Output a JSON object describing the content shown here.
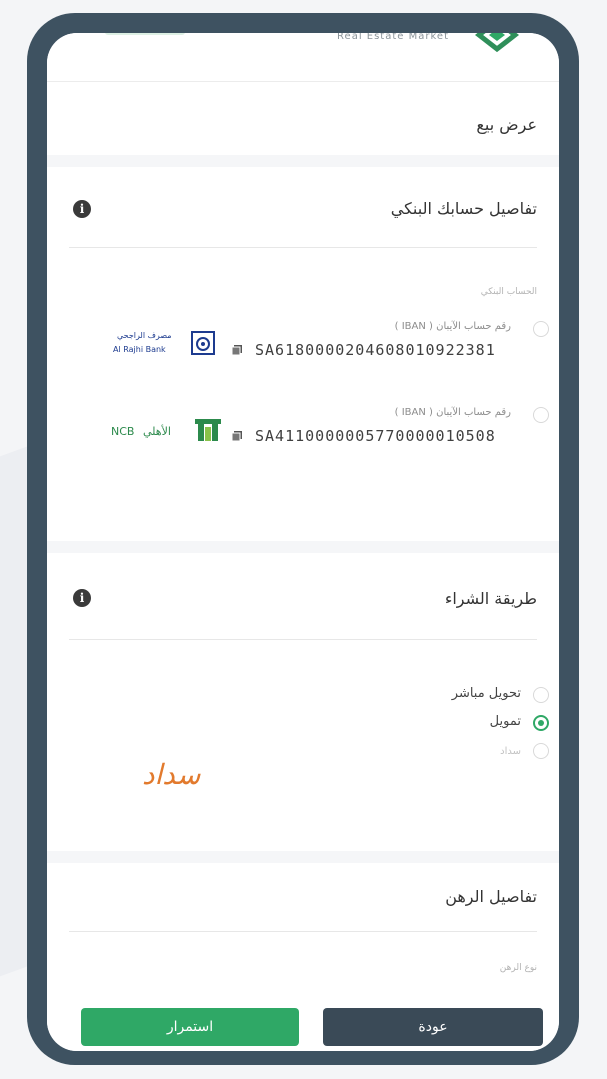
{
  "header": {
    "brand_text": "Real Estate Market"
  },
  "page_title": "عرض بيع",
  "bank_section": {
    "title": "تفاصيل حسابك البنكي",
    "info_icon": "i",
    "group_label": "الحساب البنكي",
    "accounts": [
      {
        "label": "رقم حساب الآيبان ( IBAN )",
        "iban": "SA6180000204608010922381",
        "bank_ar": "مصرف الراجحي",
        "bank_en": "Al Rajhi Bank",
        "icon": "alrajhi-logo"
      },
      {
        "label": "رقم حساب الآيبان ( IBAN )",
        "iban": "SA4110000005770000010508",
        "bank_ar": "الأهلي",
        "bank_en": "NCB",
        "icon": "ncb-logo"
      }
    ]
  },
  "purchase_section": {
    "title": "طريقة الشراء",
    "info_icon": "i",
    "options": [
      {
        "label": "تحويل مباشر",
        "selected": false
      },
      {
        "label": "تمويل",
        "selected": true
      },
      {
        "label": "سداد",
        "selected": false
      }
    ],
    "sadad_logo_text": "سداد"
  },
  "mortgage_section": {
    "title": "تفاصيل الرهن",
    "field_label": "نوع الرهن"
  },
  "buttons": {
    "continue": "استمرار",
    "back": "عودة"
  },
  "colors": {
    "frame": "#3e5261",
    "primary": "#2fa866",
    "secondary": "#3a4a57",
    "sadad": "#e27a2d"
  }
}
